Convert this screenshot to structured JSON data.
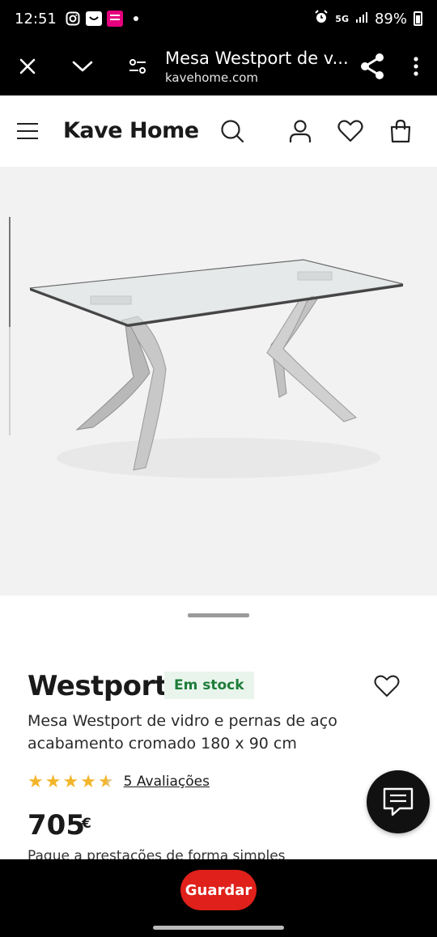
{
  "status_bar": {
    "time": "12:51",
    "network": "5G",
    "battery": "89%"
  },
  "tab_bar": {
    "title": "Mesa Westport de v...",
    "url": "kavehome.com"
  },
  "site": {
    "logo": "Kave Home"
  },
  "product": {
    "name": "Westport",
    "stock": "Em stock",
    "description": "Mesa Westport de vidro e pernas de aço acabamento cromado 180 x 90 cm",
    "rating_value": 4.5,
    "rating_max": 5,
    "reviews": "5 Avaliações",
    "price": "705",
    "currency": "€",
    "installments": "Pague a prestações de forma simples"
  },
  "bottom": {
    "save_label": "Guardar"
  },
  "colors": {
    "accent": "#e0201a",
    "star": "#f3b52a",
    "stock_text": "#1e7d3a",
    "stock_bg": "#e9f5ec"
  }
}
